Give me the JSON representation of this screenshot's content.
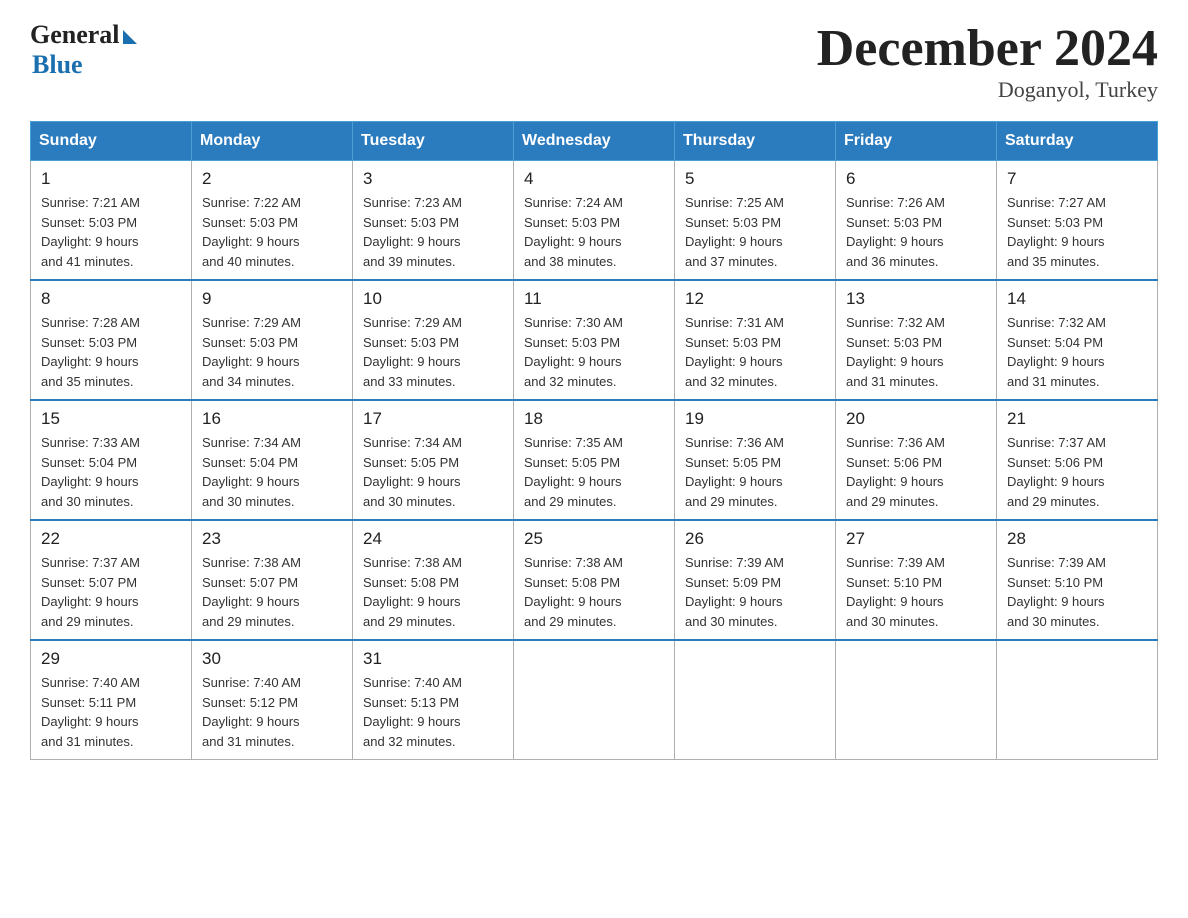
{
  "header": {
    "logo": {
      "general": "General",
      "blue": "Blue"
    },
    "title": "December 2024",
    "location": "Doganyol, Turkey"
  },
  "days_of_week": [
    "Sunday",
    "Monday",
    "Tuesday",
    "Wednesday",
    "Thursday",
    "Friday",
    "Saturday"
  ],
  "weeks": [
    [
      {
        "day": "1",
        "sunrise": "7:21 AM",
        "sunset": "5:03 PM",
        "daylight": "9 hours and 41 minutes."
      },
      {
        "day": "2",
        "sunrise": "7:22 AM",
        "sunset": "5:03 PM",
        "daylight": "9 hours and 40 minutes."
      },
      {
        "day": "3",
        "sunrise": "7:23 AM",
        "sunset": "5:03 PM",
        "daylight": "9 hours and 39 minutes."
      },
      {
        "day": "4",
        "sunrise": "7:24 AM",
        "sunset": "5:03 PM",
        "daylight": "9 hours and 38 minutes."
      },
      {
        "day": "5",
        "sunrise": "7:25 AM",
        "sunset": "5:03 PM",
        "daylight": "9 hours and 37 minutes."
      },
      {
        "day": "6",
        "sunrise": "7:26 AM",
        "sunset": "5:03 PM",
        "daylight": "9 hours and 36 minutes."
      },
      {
        "day": "7",
        "sunrise": "7:27 AM",
        "sunset": "5:03 PM",
        "daylight": "9 hours and 35 minutes."
      }
    ],
    [
      {
        "day": "8",
        "sunrise": "7:28 AM",
        "sunset": "5:03 PM",
        "daylight": "9 hours and 35 minutes."
      },
      {
        "day": "9",
        "sunrise": "7:29 AM",
        "sunset": "5:03 PM",
        "daylight": "9 hours and 34 minutes."
      },
      {
        "day": "10",
        "sunrise": "7:29 AM",
        "sunset": "5:03 PM",
        "daylight": "9 hours and 33 minutes."
      },
      {
        "day": "11",
        "sunrise": "7:30 AM",
        "sunset": "5:03 PM",
        "daylight": "9 hours and 32 minutes."
      },
      {
        "day": "12",
        "sunrise": "7:31 AM",
        "sunset": "5:03 PM",
        "daylight": "9 hours and 32 minutes."
      },
      {
        "day": "13",
        "sunrise": "7:32 AM",
        "sunset": "5:03 PM",
        "daylight": "9 hours and 31 minutes."
      },
      {
        "day": "14",
        "sunrise": "7:32 AM",
        "sunset": "5:04 PM",
        "daylight": "9 hours and 31 minutes."
      }
    ],
    [
      {
        "day": "15",
        "sunrise": "7:33 AM",
        "sunset": "5:04 PM",
        "daylight": "9 hours and 30 minutes."
      },
      {
        "day": "16",
        "sunrise": "7:34 AM",
        "sunset": "5:04 PM",
        "daylight": "9 hours and 30 minutes."
      },
      {
        "day": "17",
        "sunrise": "7:34 AM",
        "sunset": "5:05 PM",
        "daylight": "9 hours and 30 minutes."
      },
      {
        "day": "18",
        "sunrise": "7:35 AM",
        "sunset": "5:05 PM",
        "daylight": "9 hours and 29 minutes."
      },
      {
        "day": "19",
        "sunrise": "7:36 AM",
        "sunset": "5:05 PM",
        "daylight": "9 hours and 29 minutes."
      },
      {
        "day": "20",
        "sunrise": "7:36 AM",
        "sunset": "5:06 PM",
        "daylight": "9 hours and 29 minutes."
      },
      {
        "day": "21",
        "sunrise": "7:37 AM",
        "sunset": "5:06 PM",
        "daylight": "9 hours and 29 minutes."
      }
    ],
    [
      {
        "day": "22",
        "sunrise": "7:37 AM",
        "sunset": "5:07 PM",
        "daylight": "9 hours and 29 minutes."
      },
      {
        "day": "23",
        "sunrise": "7:38 AM",
        "sunset": "5:07 PM",
        "daylight": "9 hours and 29 minutes."
      },
      {
        "day": "24",
        "sunrise": "7:38 AM",
        "sunset": "5:08 PM",
        "daylight": "9 hours and 29 minutes."
      },
      {
        "day": "25",
        "sunrise": "7:38 AM",
        "sunset": "5:08 PM",
        "daylight": "9 hours and 29 minutes."
      },
      {
        "day": "26",
        "sunrise": "7:39 AM",
        "sunset": "5:09 PM",
        "daylight": "9 hours and 30 minutes."
      },
      {
        "day": "27",
        "sunrise": "7:39 AM",
        "sunset": "5:10 PM",
        "daylight": "9 hours and 30 minutes."
      },
      {
        "day": "28",
        "sunrise": "7:39 AM",
        "sunset": "5:10 PM",
        "daylight": "9 hours and 30 minutes."
      }
    ],
    [
      {
        "day": "29",
        "sunrise": "7:40 AM",
        "sunset": "5:11 PM",
        "daylight": "9 hours and 31 minutes."
      },
      {
        "day": "30",
        "sunrise": "7:40 AM",
        "sunset": "5:12 PM",
        "daylight": "9 hours and 31 minutes."
      },
      {
        "day": "31",
        "sunrise": "7:40 AM",
        "sunset": "5:13 PM",
        "daylight": "9 hours and 32 minutes."
      },
      null,
      null,
      null,
      null
    ]
  ],
  "labels": {
    "sunrise": "Sunrise:",
    "sunset": "Sunset:",
    "daylight": "Daylight:"
  }
}
